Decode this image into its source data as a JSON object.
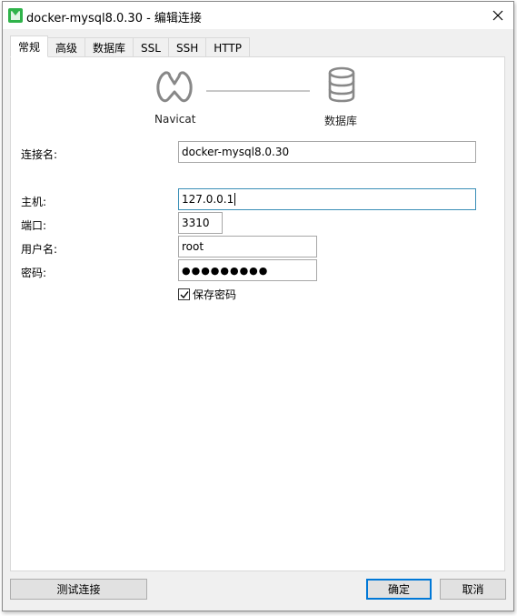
{
  "window": {
    "title": "docker-mysql8.0.30 - 编辑连接"
  },
  "tabs": [
    {
      "label": "常规",
      "active": true
    },
    {
      "label": "高级"
    },
    {
      "label": "数据库"
    },
    {
      "label": "SSL"
    },
    {
      "label": "SSH"
    },
    {
      "label": "HTTP"
    }
  ],
  "diagram": {
    "left_label": "Navicat",
    "right_label": "数据库",
    "left_icon": "navicat-logo-icon",
    "right_icon": "database-icon"
  },
  "form": {
    "connection_name_label": "连接名:",
    "connection_name_value": "docker-mysql8.0.30",
    "host_label": "主机:",
    "host_value": "127.0.0.1",
    "port_label": "端口:",
    "port_value": "3310",
    "user_label": "用户名:",
    "user_value": "root",
    "password_label": "密码:",
    "password_value": "●●●●●●●●●",
    "save_password_label": "保存密码",
    "save_password_checked": true
  },
  "footer": {
    "test_button": "测试连接",
    "ok_button": "确定",
    "cancel_button": "取消"
  },
  "colors": {
    "accent": "#0078d7",
    "focus_border": "#3a8fb7",
    "app_icon": "#2fb34a"
  }
}
